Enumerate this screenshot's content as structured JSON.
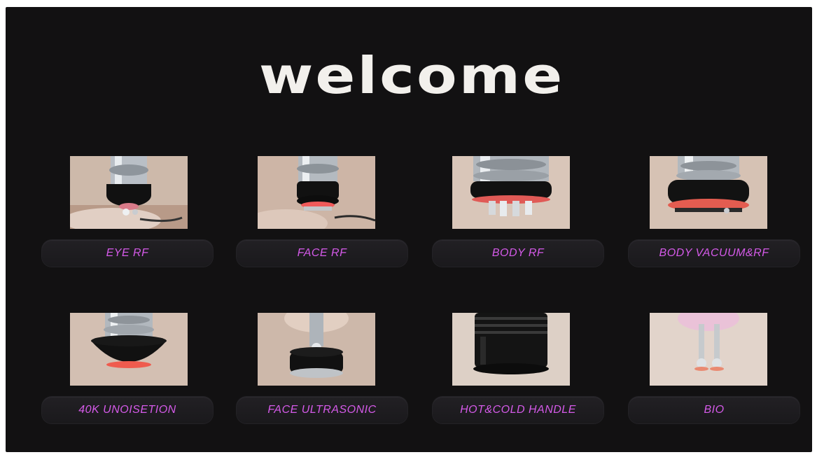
{
  "screen": {
    "title": "welcome",
    "background": "#121112",
    "label_color": "#d55ae9"
  },
  "modules": [
    {
      "label": "EYE RF",
      "icon": "eye-rf-handpiece-icon"
    },
    {
      "label": "FACE RF",
      "icon": "face-rf-handpiece-icon"
    },
    {
      "label": "BODY RF",
      "icon": "body-rf-handpiece-icon"
    },
    {
      "label": "BODY VACUUM&RF",
      "icon": "body-vacuum-rf-handpiece-icon"
    },
    {
      "label": "40K UNOISETION",
      "icon": "cavitation-40k-handpiece-icon"
    },
    {
      "label": "FACE ULTRASONIC",
      "icon": "face-ultrasonic-handpiece-icon"
    },
    {
      "label": "HOT&COLD HANDLE",
      "icon": "hot-cold-handle-icon"
    },
    {
      "label": "BIO",
      "icon": "bio-handpiece-icon"
    }
  ]
}
